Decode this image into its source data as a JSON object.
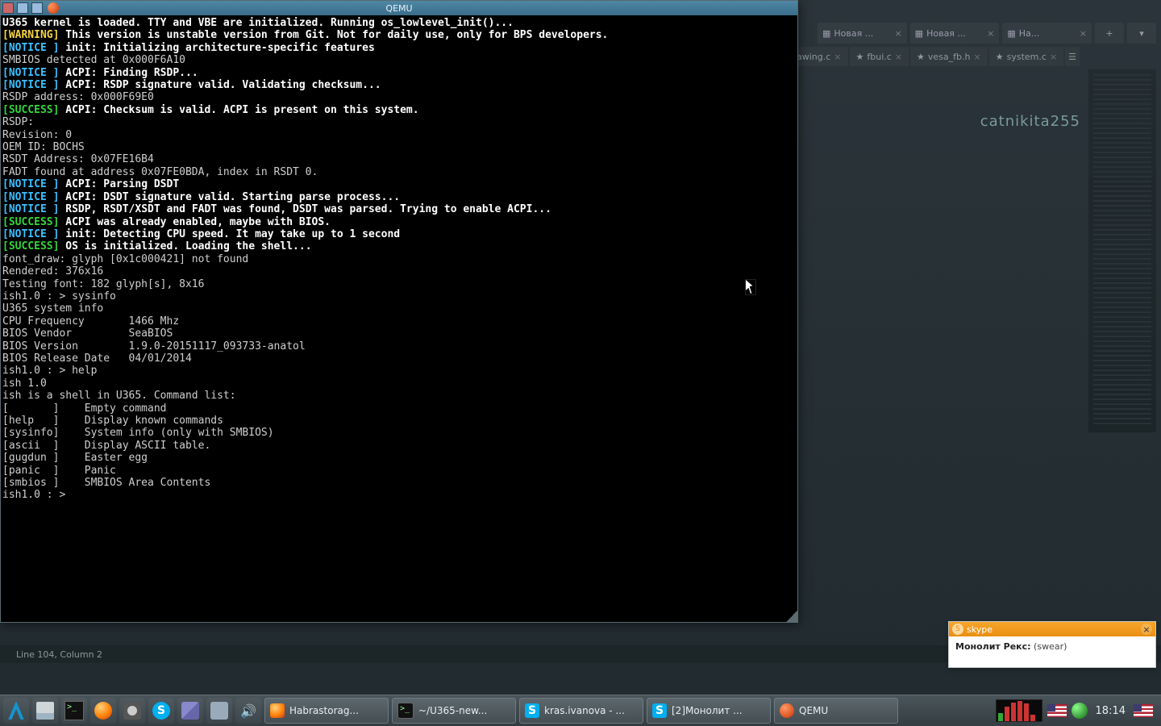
{
  "qemu": {
    "title": "QEMU",
    "lines": [
      {
        "segs": [
          {
            "t": "U365 kernel is loaded. TTY and VBE are initialized. Running os_lowlevel_init()...",
            "c": "c-white"
          }
        ]
      },
      {
        "segs": [
          {
            "t": "[WARNING]",
            "c": "c-yellow"
          },
          {
            "t": " This version is unstable version from Git. Not for daily use, only for BPS developers.",
            "c": "c-white"
          }
        ]
      },
      {
        "segs": [
          {
            "t": "",
            "c": "c-grey"
          }
        ]
      },
      {
        "segs": [
          {
            "t": "[NOTICE ]",
            "c": "c-cyan"
          },
          {
            "t": " init: Initializing architecture-specific features",
            "c": "c-white"
          }
        ]
      },
      {
        "segs": [
          {
            "t": "",
            "c": "c-grey"
          }
        ]
      },
      {
        "segs": [
          {
            "t": "SMBIOS detected at 0x000F6A10",
            "c": "c-grey"
          }
        ]
      },
      {
        "segs": [
          {
            "t": "[NOTICE ]",
            "c": "c-cyan"
          },
          {
            "t": " ACPI: Finding RSDP...",
            "c": "c-white"
          }
        ]
      },
      {
        "segs": [
          {
            "t": "[NOTICE ]",
            "c": "c-cyan"
          },
          {
            "t": " ACPI: RSDP signature valid. Validating checksum...",
            "c": "c-white"
          }
        ]
      },
      {
        "segs": [
          {
            "t": "RSDP address: 0x000F69E0",
            "c": "c-grey"
          }
        ]
      },
      {
        "segs": [
          {
            "t": "[SUCCESS]",
            "c": "c-green"
          },
          {
            "t": " ACPI: Checksum is valid. ACPI is present on this system.",
            "c": "c-white"
          }
        ]
      },
      {
        "segs": [
          {
            "t": "RSDP:",
            "c": "c-grey"
          }
        ]
      },
      {
        "segs": [
          {
            "t": "Revision: 0",
            "c": "c-grey"
          }
        ]
      },
      {
        "segs": [
          {
            "t": "OEM ID: BOCHS",
            "c": "c-grey"
          }
        ]
      },
      {
        "segs": [
          {
            "t": "RSDT Address: 0x07FE16B4",
            "c": "c-grey"
          }
        ]
      },
      {
        "segs": [
          {
            "t": "FADT found at address 0x07FE0BDA, index in RSDT 0.",
            "c": "c-grey"
          }
        ]
      },
      {
        "segs": [
          {
            "t": "[NOTICE ]",
            "c": "c-cyan"
          },
          {
            "t": " ACPI: Parsing DSDT",
            "c": "c-white"
          }
        ]
      },
      {
        "segs": [
          {
            "t": "[NOTICE ]",
            "c": "c-cyan"
          },
          {
            "t": " ACPI: DSDT signature valid. Starting parse process...",
            "c": "c-white"
          }
        ]
      },
      {
        "segs": [
          {
            "t": "[NOTICE ]",
            "c": "c-cyan"
          },
          {
            "t": " RSDP, RSDT/XSDT and FADT was found, DSDT was parsed. Trying to enable ACPI...",
            "c": "c-white"
          }
        ]
      },
      {
        "segs": [
          {
            "t": "[SUCCESS]",
            "c": "c-green"
          },
          {
            "t": " ACPI was already enabled, maybe with BIOS.",
            "c": "c-white"
          }
        ]
      },
      {
        "segs": [
          {
            "t": "",
            "c": "c-grey"
          }
        ]
      },
      {
        "segs": [
          {
            "t": "[NOTICE ]",
            "c": "c-cyan"
          },
          {
            "t": " init: Detecting CPU speed. It may take up to 1 second",
            "c": "c-white"
          }
        ]
      },
      {
        "segs": [
          {
            "t": "[SUCCESS]",
            "c": "c-green"
          },
          {
            "t": " OS is initialized. Loading the shell...",
            "c": "c-white"
          }
        ]
      },
      {
        "segs": [
          {
            "t": "font_draw: glyph [0x1c000421] not found",
            "c": "c-grey"
          }
        ]
      },
      {
        "segs": [
          {
            "t": "Rendered: 376x16",
            "c": "c-grey"
          }
        ]
      },
      {
        "segs": [
          {
            "t": "Testing font: 182 glyph[s], 8x16",
            "c": "c-grey"
          }
        ]
      },
      {
        "segs": [
          {
            "t": "",
            "c": "c-grey"
          }
        ]
      },
      {
        "segs": [
          {
            "t": "ish1.0 : > sysinfo",
            "c": "c-grey"
          }
        ]
      },
      {
        "segs": [
          {
            "t": "U365 system info",
            "c": "c-grey"
          }
        ]
      },
      {
        "segs": [
          {
            "t": "CPU Frequency       1466 Mhz",
            "c": "c-grey"
          }
        ]
      },
      {
        "segs": [
          {
            "t": "BIOS Vendor         SeaBIOS",
            "c": "c-grey"
          }
        ]
      },
      {
        "segs": [
          {
            "t": "BIOS Version        1.9.0-20151117_093733-anatol",
            "c": "c-grey"
          }
        ]
      },
      {
        "segs": [
          {
            "t": "BIOS Release Date   04/01/2014",
            "c": "c-grey"
          }
        ]
      },
      {
        "segs": [
          {
            "t": "",
            "c": "c-grey"
          }
        ]
      },
      {
        "segs": [
          {
            "t": "ish1.0 : > help",
            "c": "c-grey"
          }
        ]
      },
      {
        "segs": [
          {
            "t": "ish 1.0",
            "c": "c-grey"
          }
        ]
      },
      {
        "segs": [
          {
            "t": "ish is a shell in U365. Command list:",
            "c": "c-grey"
          }
        ]
      },
      {
        "segs": [
          {
            "t": "[       ]    Empty command",
            "c": "c-grey"
          }
        ]
      },
      {
        "segs": [
          {
            "t": "[help   ]    Display known commands",
            "c": "c-grey"
          }
        ]
      },
      {
        "segs": [
          {
            "t": "[sysinfo]    System info (only with SMBIOS)",
            "c": "c-grey"
          }
        ]
      },
      {
        "segs": [
          {
            "t": "[ascii  ]    Display ASCII table.",
            "c": "c-grey"
          }
        ]
      },
      {
        "segs": [
          {
            "t": "[gugdun ]    Easter egg",
            "c": "c-grey"
          }
        ]
      },
      {
        "segs": [
          {
            "t": "[panic  ]    Panic",
            "c": "c-grey"
          }
        ]
      },
      {
        "segs": [
          {
            "t": "[smbios ]    SMBIOS Area Contents",
            "c": "c-grey"
          }
        ]
      },
      {
        "segs": [
          {
            "t": "",
            "c": "c-grey"
          }
        ]
      },
      {
        "segs": [
          {
            "t": "ish1.0 : > ",
            "c": "c-grey"
          }
        ]
      }
    ]
  },
  "backdrop": {
    "browser_tabs": [
      "Новая ...",
      "Новая ...",
      "На..."
    ],
    "editor_tabs": [
      "awing.c",
      "fbui.c",
      "vesa_fb.h",
      "system.c"
    ],
    "username": "catnikita255",
    "statusbar": "Line 104, Column 2"
  },
  "skype": {
    "brand": "skype",
    "sender": "Монолит Рекс:",
    "msg": "(swear)"
  },
  "taskbar": {
    "items": [
      {
        "icon": "firefox",
        "label": "Habrastorag..."
      },
      {
        "icon": "term",
        "label": "~/U365-new..."
      },
      {
        "icon": "skype",
        "label": "kras.ivanova - ..."
      },
      {
        "icon": "skype",
        "label": "[2]Монолит ..."
      },
      {
        "icon": "qemu",
        "label": "QEMU"
      }
    ],
    "clock": "18:14"
  }
}
